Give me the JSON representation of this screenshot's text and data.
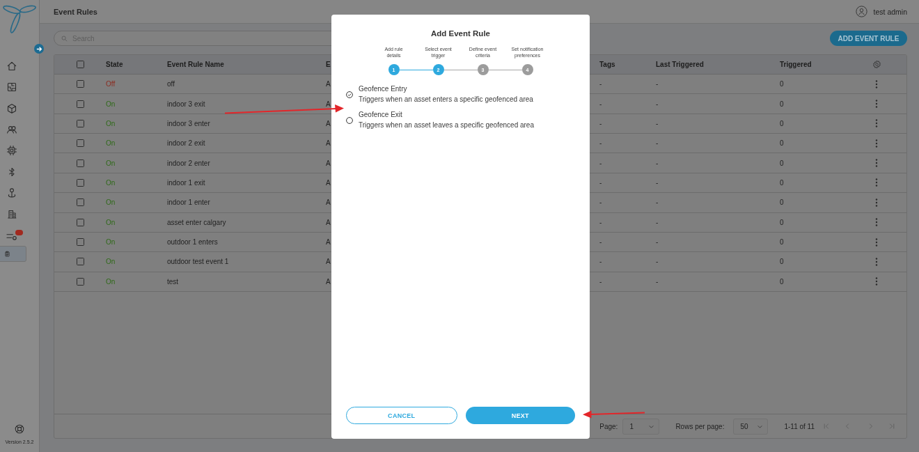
{
  "sidebar": {
    "items": [
      {
        "selected": false
      },
      {
        "selected": false
      },
      {
        "selected": false
      },
      {
        "selected": false
      },
      {
        "selected": false
      },
      {
        "selected": false
      },
      {
        "selected": false
      },
      {
        "selected": false
      },
      {
        "selected": false,
        "badge": true
      },
      {
        "selected": true
      }
    ],
    "version": "Version 2.5.2"
  },
  "header": {
    "title": "Event Rules",
    "user": "test admin"
  },
  "toolbar": {
    "search": {
      "placeholder": "Search"
    },
    "add_button": "ADD EVENT RULE"
  },
  "table": {
    "select_all": {
      "checked": false
    },
    "columns": [
      "State",
      "Event Rule Name",
      "E",
      "Tags",
      "Last Triggered",
      "Triggered"
    ],
    "rows": [
      {
        "checked": false,
        "enabled": false,
        "state": "Off",
        "name": "off",
        "column_4": "A",
        "tags": "-",
        "last_triggered": "-",
        "triggered": "0"
      },
      {
        "checked": false,
        "enabled": true,
        "state": "On",
        "name": "indoor 3 exit",
        "column_4": "A",
        "tags": "-",
        "last_triggered": "-",
        "triggered": "0"
      },
      {
        "checked": false,
        "enabled": true,
        "state": "On",
        "name": "indoor 3 enter",
        "column_4": "A",
        "tags": "-",
        "last_triggered": "-",
        "triggered": "0"
      },
      {
        "checked": false,
        "enabled": true,
        "state": "On",
        "name": "indoor 2 exit",
        "column_4": "A",
        "tags": "-",
        "last_triggered": "-",
        "triggered": "0"
      },
      {
        "checked": false,
        "enabled": true,
        "state": "On",
        "name": "indoor 2 enter",
        "column_4": "A",
        "tags": "-",
        "last_triggered": "-",
        "triggered": "0"
      },
      {
        "checked": false,
        "enabled": true,
        "state": "On",
        "name": "indoor 1 exit",
        "column_4": "A",
        "tags": "-",
        "last_triggered": "-",
        "triggered": "0"
      },
      {
        "checked": false,
        "enabled": true,
        "state": "On",
        "name": "indoor 1 enter",
        "column_4": "A",
        "tags": "-",
        "last_triggered": "-",
        "triggered": "0"
      },
      {
        "checked": false,
        "enabled": true,
        "state": "On",
        "name": "asset enter calgary",
        "column_4": "A",
        "tags": "-",
        "last_triggered": "-",
        "triggered": "0"
      },
      {
        "checked": false,
        "enabled": true,
        "state": "On",
        "name": "outdoor 1 enters",
        "column_4": "A",
        "tags": "-",
        "last_triggered": "-",
        "triggered": "0"
      },
      {
        "checked": false,
        "enabled": true,
        "state": "On",
        "name": "outdoor test event 1",
        "column_4": "A",
        "tags": "-",
        "last_triggered": "-",
        "triggered": "0"
      },
      {
        "checked": false,
        "enabled": true,
        "state": "On",
        "name": "test",
        "column_4": "A",
        "tags": "-",
        "last_triggered": "-",
        "triggered": "0"
      }
    ],
    "pagination": {
      "page_label": "Page:",
      "page": "1",
      "rows_label": "Rows per page:",
      "rows_per_page": "50",
      "range": "1-11 of 11"
    }
  },
  "dialog": {
    "title": "Add Event Rule",
    "steps": [
      {
        "number": "1",
        "label": "Add rule details",
        "active": true
      },
      {
        "number": "2",
        "label": "Select event trigger",
        "active": true
      },
      {
        "number": "3",
        "label": "Define event criteria",
        "active": false
      },
      {
        "number": "4",
        "label": "Set notification preferences",
        "active": false
      }
    ],
    "options": [
      {
        "title": "Geofence Entry",
        "description": "Triggers when an asset enters a specific geofenced area",
        "selected": true
      },
      {
        "title": "Geofence Exit",
        "description": "Triggers when an asset leaves a specific geofenced area",
        "selected": false
      }
    ],
    "buttons": [
      {
        "label": "CANCEL",
        "kind": "secondary"
      },
      {
        "label": "NEXT",
        "kind": "primary"
      }
    ]
  }
}
